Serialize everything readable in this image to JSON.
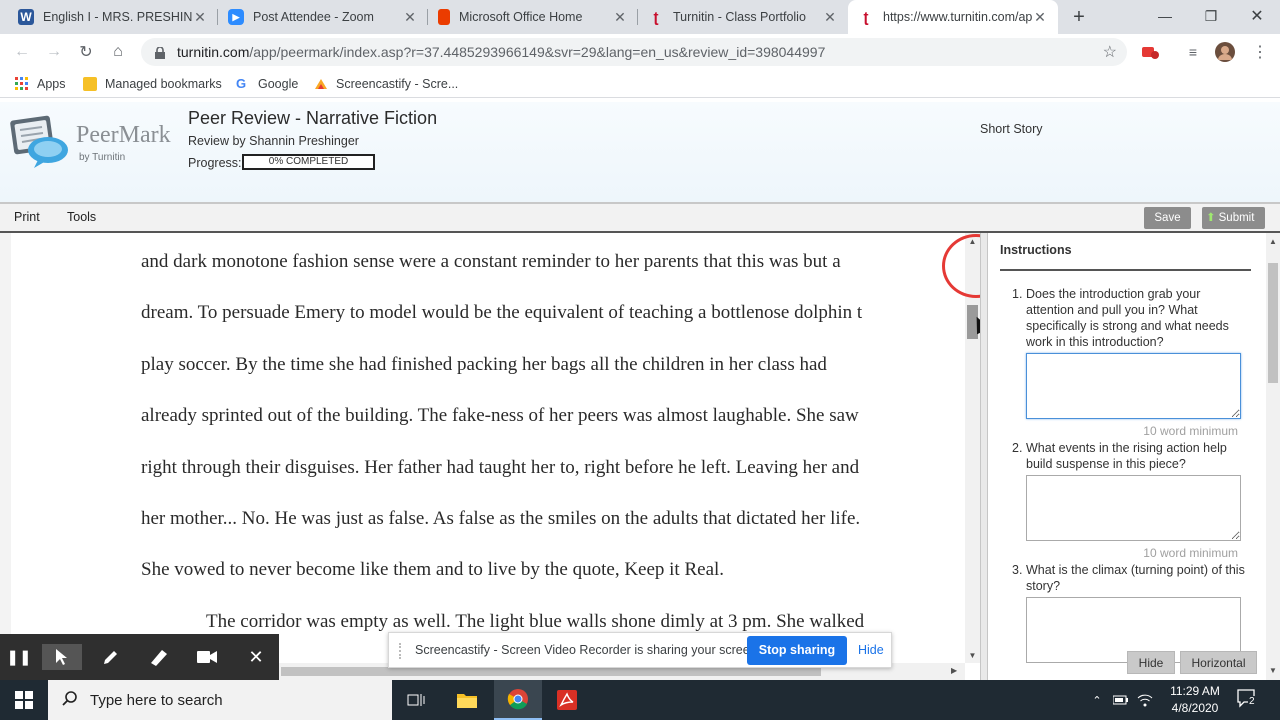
{
  "browser": {
    "tabs": [
      {
        "title": "English I - MRS. PRESHINGER",
        "icon": "word-icon"
      },
      {
        "title": "Post Attendee - Zoom",
        "icon": "zoom-icon"
      },
      {
        "title": "Microsoft Office Home",
        "icon": "office-icon"
      },
      {
        "title": "Turnitin - Class Portfolio",
        "icon": "turnitin-icon"
      },
      {
        "title": "https://www.turnitin.com/app/peermark",
        "icon": "turnitin-icon"
      }
    ],
    "url_host": "turnitin.com",
    "url_rest": "/app/peermark/index.asp?r=37.4485293966149&svr=29&lang=en_us&review_id=398044997",
    "bookmarks": [
      "Apps",
      "Managed bookmarks",
      "Google",
      "Screencastify - Scre..."
    ]
  },
  "peermark": {
    "logo_word": "PeerMark",
    "logo_by": "by Turnitin",
    "title": "Peer Review - Narrative Fiction",
    "reviewer": "Review by Shannin Preshinger",
    "progress_label": "Progress:",
    "progress_text": "0% COMPLETED",
    "progress_fraction": 0,
    "assignment": "Short Story"
  },
  "menubar": {
    "print": "Print",
    "tools": "Tools",
    "save": "Save",
    "submit": "Submit"
  },
  "document": {
    "lines": [
      "and dark monotone fashion sense were a constant reminder to her parents that this was but a",
      "dream. To persuade Emery to model would be the equivalent of teaching a bottlenose dolphin t",
      "play soccer. By the time she had finished packing her bags all the children in her class had",
      "already sprinted out of the building. The fake-ness of her peers was almost laughable. She saw",
      "right through their disguises. Her father had taught her to, right before he left. Leaving her and",
      "her mother... No. He was just as false. As false as the smiles on the adults that dictated her life.",
      "She vowed to never become like them and to live by the quote, Keep it Real.",
      "The corridor was empty as well. The light blue walls shone dimly at 3 pm. She walked"
    ]
  },
  "instructions": {
    "title": "Instructions",
    "questions": [
      {
        "num": "1.",
        "text": "Does the introduction grab your attention and pull you in? What specifically is strong and what needs work in this introduction?",
        "minimum": "10 word minimum",
        "answer": ""
      },
      {
        "num": "2.",
        "text": "What events in the rising action help build suspense in this piece?",
        "minimum": "10 word minimum",
        "answer": ""
      },
      {
        "num": "3.",
        "text": "What is the climax (turning point) of this story?",
        "minimum": "",
        "answer": ""
      }
    ],
    "hide": "Hide",
    "horizontal": "Horizontal"
  },
  "screencastify": {
    "message": "Screencastify - Screen Video Recorder is sharing your screen.",
    "stop": "Stop sharing",
    "hide": "Hide"
  },
  "taskbar": {
    "search_placeholder": "Type here to search",
    "time": "11:29 AM",
    "date": "4/8/2020",
    "notification_count": "2"
  },
  "colors": {
    "accent_blue": "#1a73e8",
    "annotation_red": "#e53935",
    "taskbar": "#1f2a33"
  }
}
